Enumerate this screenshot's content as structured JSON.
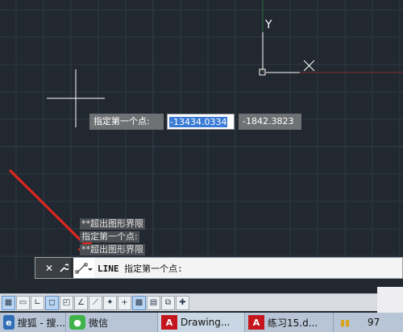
{
  "canvas": {
    "background": "#212830",
    "ucs_axis_label": "Y"
  },
  "tooltip": {
    "prompt": "指定第一个点:",
    "x_value": "-13434.0334",
    "y_value": "-1842.3823"
  },
  "command_history": [
    "**超出图形界限",
    "指定第一个点:",
    "**超出图形界限"
  ],
  "command_line": {
    "command": "LINE",
    "prompt": "指定第一个点:"
  },
  "status_bar": {
    "buttons": [
      "grid-icon",
      "snap-icon",
      "ortho-icon",
      "polar-icon",
      "osnap-icon",
      "otrack-icon",
      "ducs-icon",
      "dyn-icon",
      "lineweight-icon",
      "transparency-icon",
      "quickprops-icon",
      "selection-cycling-icon",
      "annotation-monitor-icon"
    ]
  },
  "taskbar": {
    "items": [
      {
        "label": "搜狐 - 搜..."
      },
      {
        "label": "微信"
      },
      {
        "label": "Drawing..."
      },
      {
        "label": "练习15.d..."
      },
      {
        "label": "97"
      }
    ]
  }
}
